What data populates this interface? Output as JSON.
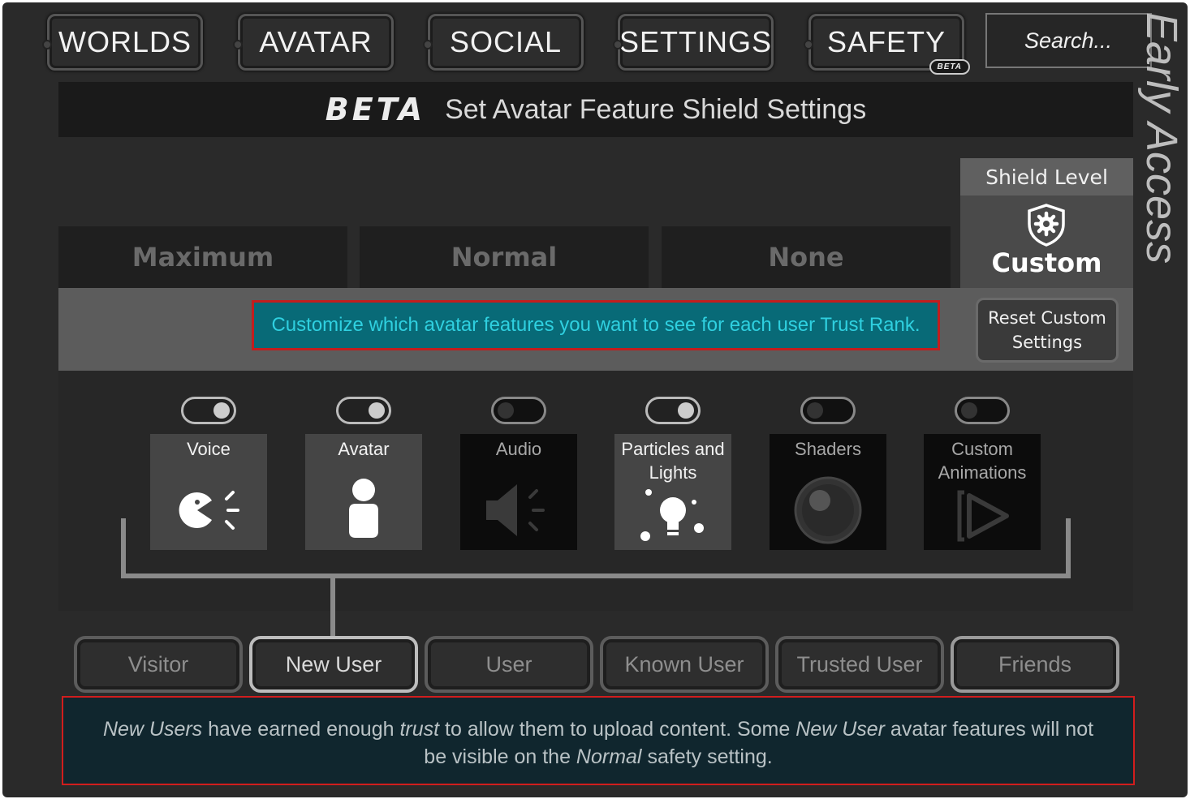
{
  "nav": {
    "worlds": "WORLDS",
    "avatar": "AVATAR",
    "social": "SOCIAL",
    "settings": "SETTINGS",
    "safety": "SAFETY",
    "safety_badge": "BETA",
    "search_placeholder": "Search..."
  },
  "side_label": "Early Access",
  "header": {
    "badge": "BETA",
    "title": "Set Avatar Feature Shield Settings"
  },
  "shield_levels": {
    "maximum": "Maximum",
    "normal": "Normal",
    "none": "None",
    "panel_title": "Shield Level",
    "current": "Custom"
  },
  "hint_text": "Customize which avatar features you want to see for each user Trust Rank.",
  "reset_button": "Reset Custom Settings",
  "features": [
    {
      "label": "Voice",
      "enabled": true,
      "icon": "voice-icon"
    },
    {
      "label": "Avatar",
      "enabled": true,
      "icon": "avatar-person-icon"
    },
    {
      "label": "Audio",
      "enabled": false,
      "icon": "speaker-icon"
    },
    {
      "label": "Particles and Lights",
      "enabled": true,
      "icon": "lightbulb-icon"
    },
    {
      "label": "Shaders",
      "enabled": false,
      "icon": "sphere-icon"
    },
    {
      "label": "Custom Animations",
      "enabled": false,
      "icon": "play-animation-icon"
    }
  ],
  "trust_ranks": {
    "visitor": "Visitor",
    "new_user": "New User",
    "user": "User",
    "known_user": "Known User",
    "trusted_user": "Trusted User",
    "friends": "Friends",
    "selected": "New User"
  },
  "description": {
    "p1": "New Users",
    "p2": " have earned enough ",
    "p3": "trust",
    "p4": " to allow them to upload content. Some ",
    "p5": "New User",
    "p6": " avatar features will not be visible on the ",
    "p7": "Normal",
    "p8": " safety setting."
  },
  "colors": {
    "hint_background": "#086a77",
    "hint_text": "#2fd0e0",
    "highlight_border": "#c21d1d",
    "description_background": "#10262e"
  }
}
